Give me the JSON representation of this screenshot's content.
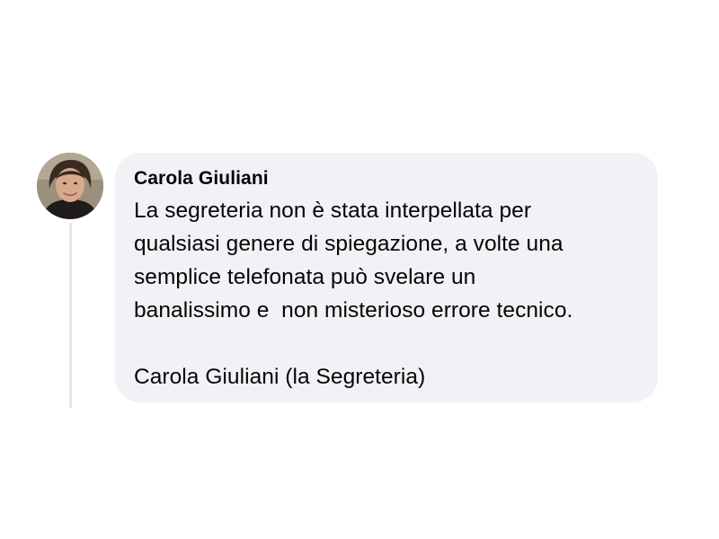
{
  "comment": {
    "author": "Carola Giuliani",
    "text": "La segreteria non è stata interpellata per\nqualsiasi genere di spiegazione, a volte una\nsemplice telefonata può svelare un\nbanalissimo e  non misterioso errore tecnico.\n\nCarola Giuliani (la Segreteria)"
  },
  "colors": {
    "bubble_background": "#f0f2f5",
    "text": "#050505",
    "thread_line": "#e4e6eb"
  }
}
